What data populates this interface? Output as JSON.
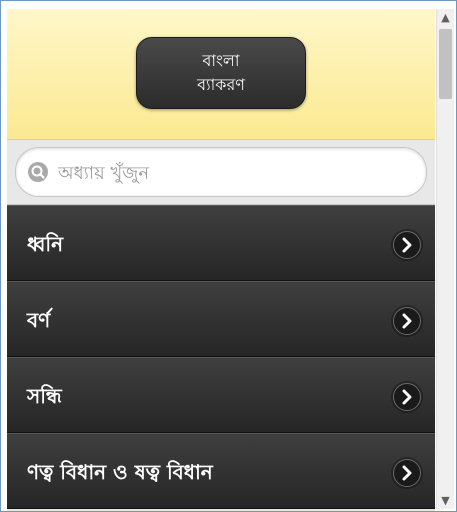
{
  "header": {
    "title_line1": "বাংলা",
    "title_line2": "ব্যাকরণ"
  },
  "search": {
    "placeholder": "অধ্যায় খুঁজুন",
    "value": ""
  },
  "chapters": [
    {
      "label": "ধ্বনি"
    },
    {
      "label": "বর্ণ"
    },
    {
      "label": "সন্ধি"
    },
    {
      "label": "ণত্ব বিধান ও ষত্ব বিধান"
    }
  ],
  "scrollbar": {
    "up_glyph": "▲",
    "down_glyph": "▼"
  },
  "colors": {
    "header_bg": "#fbe991",
    "title_bg": "#2b2b2b",
    "list_bg": "#262626",
    "window_border": "#6f97c6"
  },
  "icons": [
    "search-icon",
    "chevron-right-icon",
    "scroll-up-arrow-icon",
    "scroll-down-arrow-icon"
  ]
}
